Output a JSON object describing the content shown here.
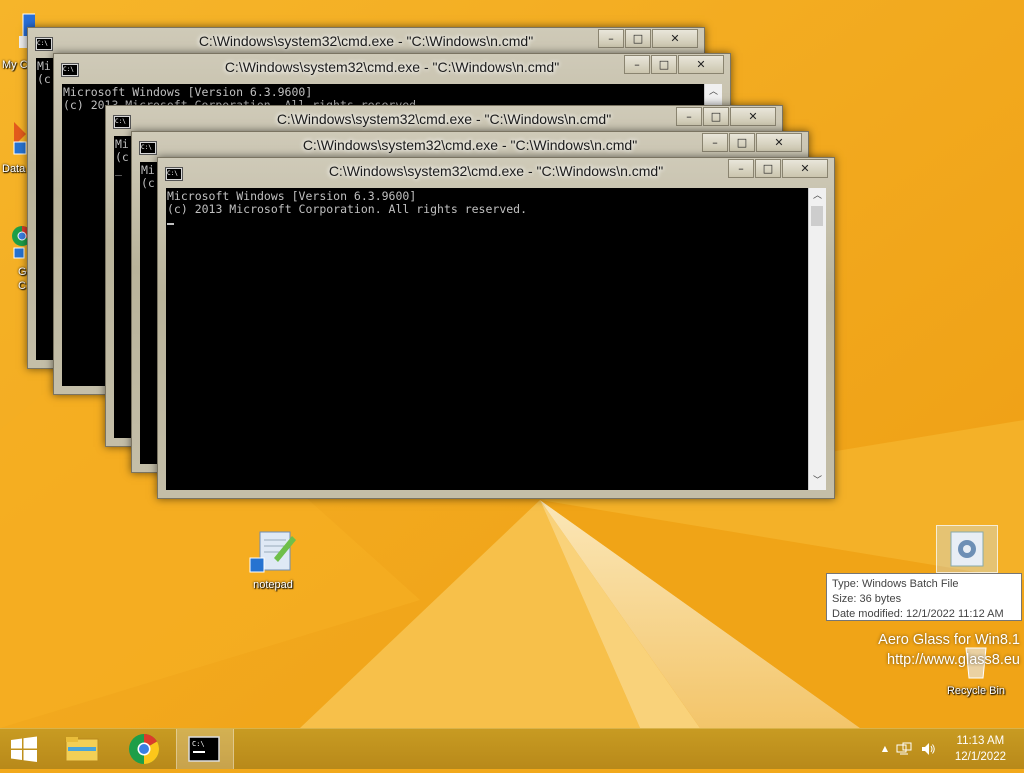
{
  "windows": [
    {
      "title": "C:\\Windows\\system32\\cmd.exe - \"C:\\Windows\\n.cmd\"",
      "lines": [
        "Mi",
        "(c",
        "_"
      ]
    },
    {
      "title": "C:\\Windows\\system32\\cmd.exe - \"C:\\Windows\\n.cmd\"",
      "lines": [
        "Microsoft Windows [Version 6.3.9600]",
        "(c) 2013 Microsoft Corporation. All rights reserved."
      ]
    },
    {
      "title": "C:\\Windows\\system32\\cmd.exe - \"C:\\Windows\\n.cmd\"",
      "lines": [
        "Mi",
        "(c",
        "_"
      ]
    },
    {
      "title": "C:\\Windows\\system32\\cmd.exe - \"C:\\Windows\\n.cmd\"",
      "lines": [
        "Mi",
        "(c"
      ]
    },
    {
      "title": "C:\\Windows\\system32\\cmd.exe - \"C:\\Windows\\n.cmd\"",
      "lines": [
        "Microsoft Windows [Version 6.3.9600]",
        "(c) 2013 Microsoft Corporation. All rights reserved."
      ]
    }
  ],
  "desktop": {
    "icons": {
      "my_computer": "My C",
      "data": "Data",
      "chrome_partial_1": "G",
      "chrome_partial_2": "C",
      "notepad": "notepad",
      "recycle_bin": "Recycle Bin"
    }
  },
  "tooltip": {
    "type": "Type: Windows Batch File",
    "size": "Size: 36 bytes",
    "modified": "Date modified: 12/1/2022 11:12 AM"
  },
  "watermark": {
    "line1": "Aero Glass for Win8.1",
    "line2": "http://www.glass8.eu"
  },
  "window_controls": {
    "minimize": "–",
    "maximize": "□",
    "close": "✕"
  },
  "taskbar": {
    "time": "11:13 AM",
    "date": "12/1/2022",
    "tray_arrow": "▲"
  },
  "colors": {
    "wallpaper": "#f2a91b",
    "taskbar": "#c0921e",
    "console_bg": "#000000",
    "console_fg": "#c0c0c0"
  }
}
